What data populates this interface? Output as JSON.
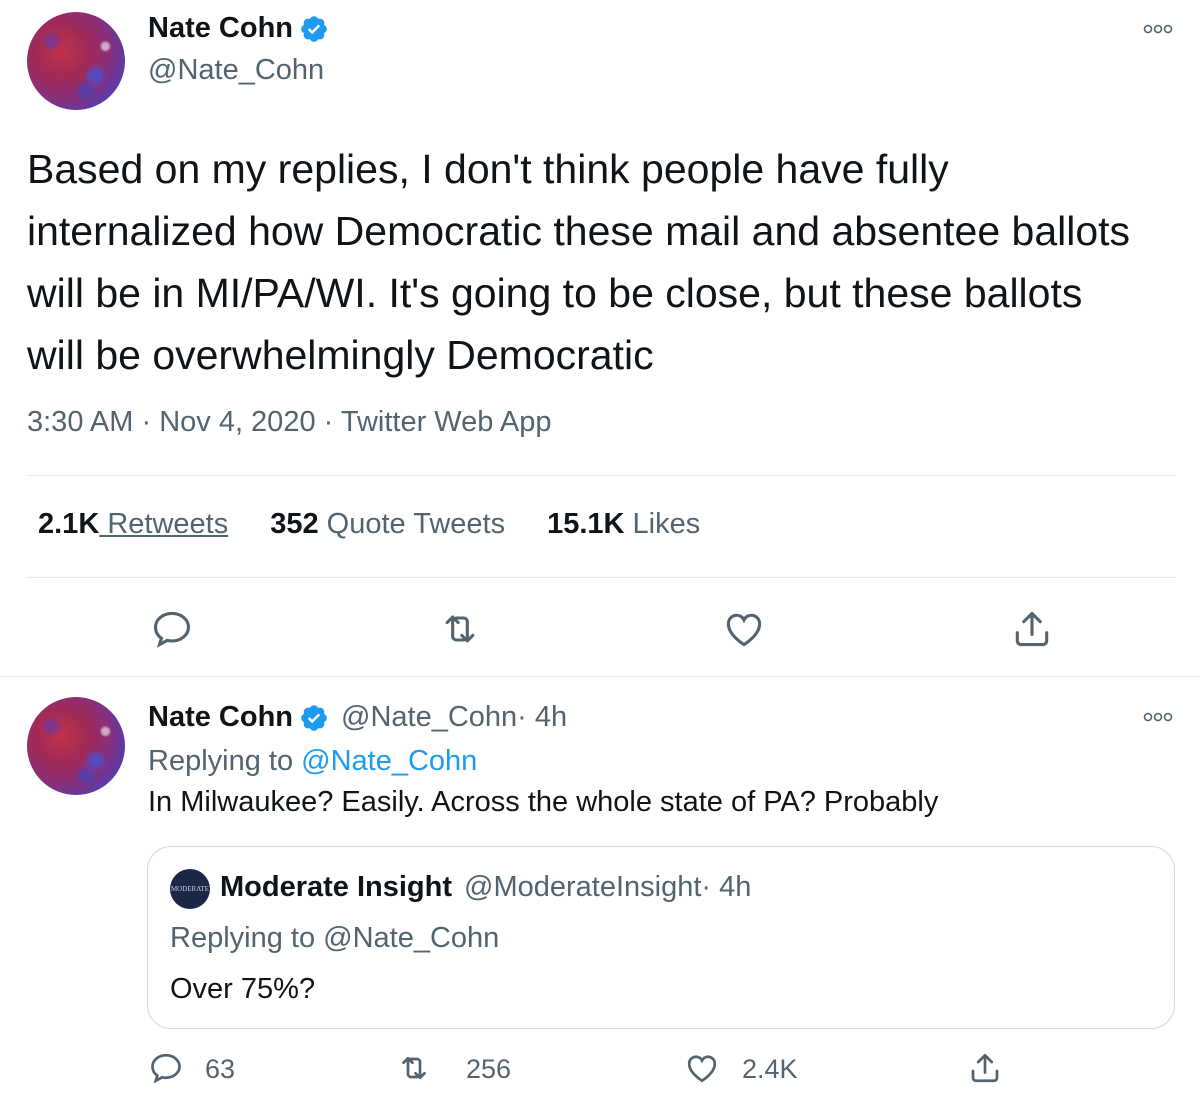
{
  "main_tweet": {
    "author_name": "Nate Cohn",
    "author_handle": "@Nate_Cohn",
    "text": "Based on my replies, I don't think people have fully internalized how Democratic these mail and absentee ballots will be in MI/PA/WI. It's going to be close, but these ballots will be overwhelmingly Democratic",
    "time": "3:30 AM",
    "date": "Nov 4, 2020",
    "source": "Twitter Web App",
    "separator": " · ",
    "stats": {
      "retweets_count": "2.1K",
      "retweets_label": " Retweets",
      "quotes_count": "352",
      "quotes_label": " Quote Tweets",
      "likes_count": "15.1K",
      "likes_label": " Likes"
    },
    "actions": [
      "reply-icon",
      "retweet-icon",
      "like-icon",
      "share-icon"
    ]
  },
  "reply_tweet": {
    "author_name": "Nate Cohn",
    "author_handle": "@Nate_Cohn",
    "age": " · 4h",
    "replying_prefix": "Replying to ",
    "replying_to": "@Nate_Cohn",
    "text": "In Milwaukee? Easily. Across the whole state of PA? Probably",
    "quoted": {
      "author_name": "Moderate Insight",
      "author_handle": "@ModerateInsight",
      "age": " · 4h",
      "avatar_text": "MODERATE",
      "replying_prefix": "Replying to ",
      "replying_to": "@Nate_Cohn",
      "text": "Over 75%?"
    },
    "counts": {
      "replies": "63",
      "retweets": "256",
      "likes": "2.4K"
    }
  },
  "colors": {
    "text_primary": "#0f1419",
    "text_secondary": "#536471",
    "accent": "#1d9bf0",
    "verified": "#1d9bf0",
    "divider": "#e1e8ed"
  }
}
